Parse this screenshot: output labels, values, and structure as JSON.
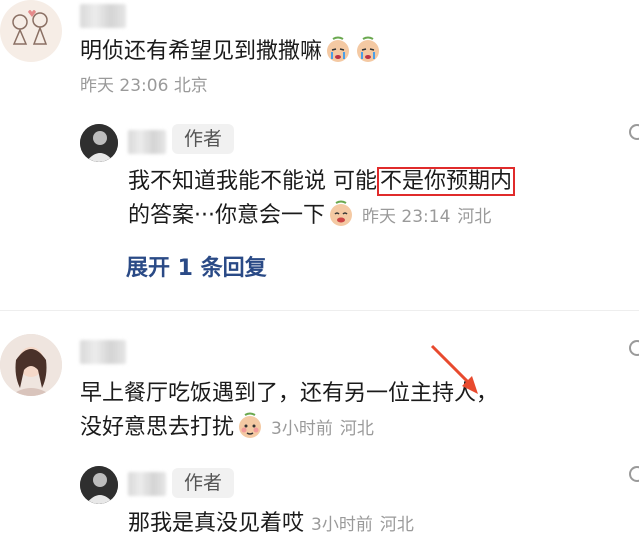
{
  "comments": [
    {
      "text": "明侦还有希望见到撒撒嘛",
      "time": "昨天 23:06",
      "location": "北京",
      "emoji_icon": "crying-face-icon"
    },
    {
      "reply_author_tag": "作者",
      "line1_pre": "我不知道我能不能说 可能",
      "line1_highlight": "不是你预期内",
      "line2": "的答案···你意会一下",
      "time": "昨天 23:14",
      "location": "河北",
      "expand_label": "展开 1 条回复"
    },
    {
      "line1": "早上餐厅吃饭遇到了，还有另一位主持人，",
      "line2": "没好意思去打扰",
      "time": "3小时前",
      "location": "河北"
    },
    {
      "reply_author_tag": "作者",
      "text": "那我是真没见着哎",
      "time": "3小时前",
      "location": "河北"
    }
  ],
  "colors": {
    "highlight_box": "#e02b2b",
    "arrow": "#e84a2e",
    "expand_link": "#2a4a86",
    "meta_text": "#9a9a9a"
  }
}
